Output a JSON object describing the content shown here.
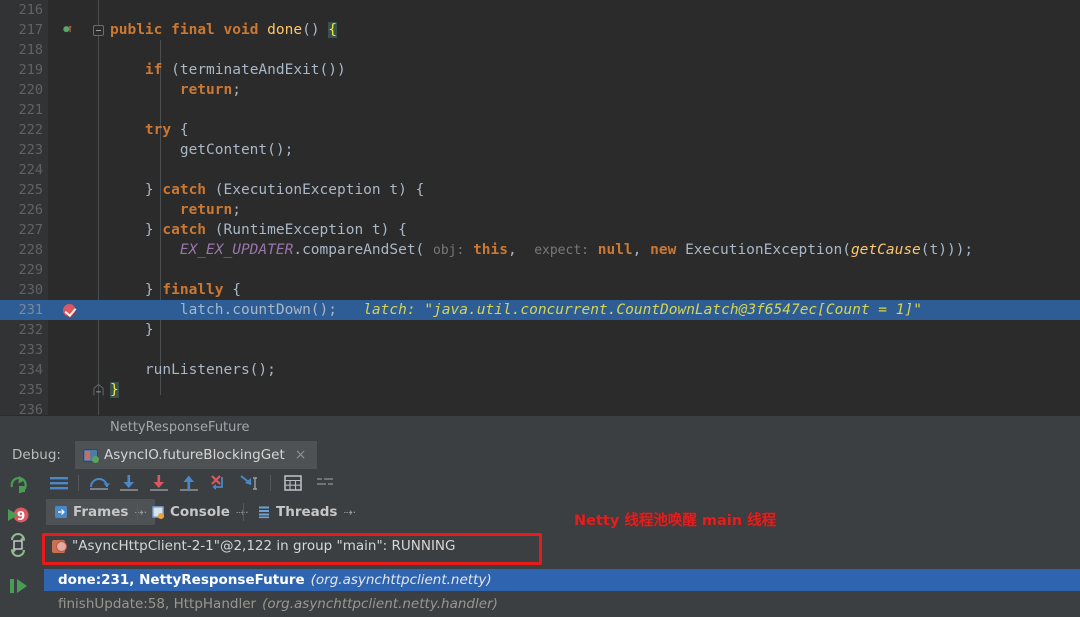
{
  "editor": {
    "first_line": 216,
    "highlight_line": 231,
    "breadcrumb": "NettyResponseFuture",
    "lines": [
      {
        "num": 216,
        "text": ""
      },
      {
        "num": 217,
        "text": "public final void done() {",
        "gutter": "override-icon",
        "fold": "fold-collapse-icon"
      },
      {
        "num": 218,
        "text": ""
      },
      {
        "num": 219,
        "text": "if (terminateAndExit())"
      },
      {
        "num": 220,
        "text": "return;"
      },
      {
        "num": 221,
        "text": ""
      },
      {
        "num": 222,
        "text": "try {"
      },
      {
        "num": 223,
        "text": "getContent();"
      },
      {
        "num": 224,
        "text": ""
      },
      {
        "num": 225,
        "text": "} catch (ExecutionException t) {"
      },
      {
        "num": 226,
        "text": "return;"
      },
      {
        "num": 227,
        "text": "} catch (RuntimeException t) {"
      },
      {
        "num": 228,
        "text": "EX_EX_UPDATER.compareAndSet( obj: this,  expect: null, new ExecutionException(getCause(t)));"
      },
      {
        "num": 229,
        "text": ""
      },
      {
        "num": 230,
        "text": "} finally {"
      },
      {
        "num": 231,
        "text": "latch.countDown();   latch: \"java.util.concurrent.CountDownLatch@3f6547ec[Count = 1]\"",
        "gutter": "breakpoint-verified-icon"
      },
      {
        "num": 232,
        "text": "}"
      },
      {
        "num": 233,
        "text": ""
      },
      {
        "num": 234,
        "text": "runListeners();"
      },
      {
        "num": 235,
        "text": "}",
        "fold": "fold-end-icon"
      },
      {
        "num": 236,
        "text": ""
      }
    ],
    "inline_debug": {
      "label": "latch:",
      "value": "\"java.util.concurrent.CountDownLatch@3f6547ec[Count = 1]\""
    },
    "param_hints": {
      "obj": "obj:",
      "expect": "expect:"
    }
  },
  "debug_header": {
    "label": "Debug:",
    "tab_title": "AsyncIO.futureBlockingGet",
    "tab_close": "×",
    "run_icon": "run-configuration-icon"
  },
  "left_toolbar": {
    "items": [
      {
        "name": "rerun-icon",
        "title": "Rerun"
      },
      {
        "name": "resume-program-icon",
        "title": "Resume Program"
      },
      {
        "name": "mute-breakpoints-icon",
        "title": "Mute Breakpoints"
      },
      {
        "name": "pause-program-icon",
        "title": "Pause Program"
      }
    ]
  },
  "debug_toolbar": {
    "items": [
      {
        "name": "show-execution-point-icon",
        "title": "Show Execution Point"
      },
      {
        "name": "step-over-icon",
        "title": "Step Over"
      },
      {
        "name": "step-into-icon",
        "title": "Step Into"
      },
      {
        "name": "force-step-into-icon",
        "title": "Force Step Into"
      },
      {
        "name": "step-out-icon",
        "title": "Step Out"
      },
      {
        "name": "drop-frame-icon",
        "title": "Drop Frame"
      },
      {
        "name": "run-to-cursor-icon",
        "title": "Run to Cursor"
      },
      {
        "name": "evaluate-expression-icon",
        "title": "Evaluate Expression"
      },
      {
        "name": "settings-list-icon",
        "title": "Layout Settings"
      }
    ]
  },
  "debug_tabs": [
    {
      "label": "Frames",
      "icon": "frames-icon",
      "pin": "⇢·",
      "selected": true
    },
    {
      "label": "Console",
      "icon": "console-icon",
      "pin": "⇢·",
      "selected": false
    },
    {
      "label": "Threads",
      "icon": "threads-icon",
      "pin": "⇢·",
      "selected": false
    }
  ],
  "frames_panel": {
    "thread_selector": {
      "icon": "thread-running-icon",
      "label": "\"AsyncHttpClient-2-1\"@2,122 in group \"main\": RUNNING"
    },
    "frames": [
      {
        "method": "done:231, NettyResponseFuture",
        "package": "(org.asynchttpclient.netty)",
        "selected": true
      },
      {
        "method": "finishUpdate:58, HttpHandler",
        "package": "(org.asynchttpclient.netty.handler)",
        "selected": false
      }
    ]
  },
  "annotation": {
    "text": "Netty 线程池唤醒 main 线程",
    "color": "#e01f1f",
    "box_color": "#e81b1b"
  },
  "colors": {
    "editor_bg": "#2b2b2b",
    "gutter_bg": "#313335",
    "panel_bg": "#3c3f41",
    "selection_blue": "#2e5c94",
    "frame_selected_blue": "#2f65b0",
    "keyword_orange": "#cc7832",
    "method_yellow": "#ffc66d",
    "plain_text": "#a9b7c6",
    "field_purple": "#9876aa",
    "inline_debug_yellow": "#d5d552"
  }
}
